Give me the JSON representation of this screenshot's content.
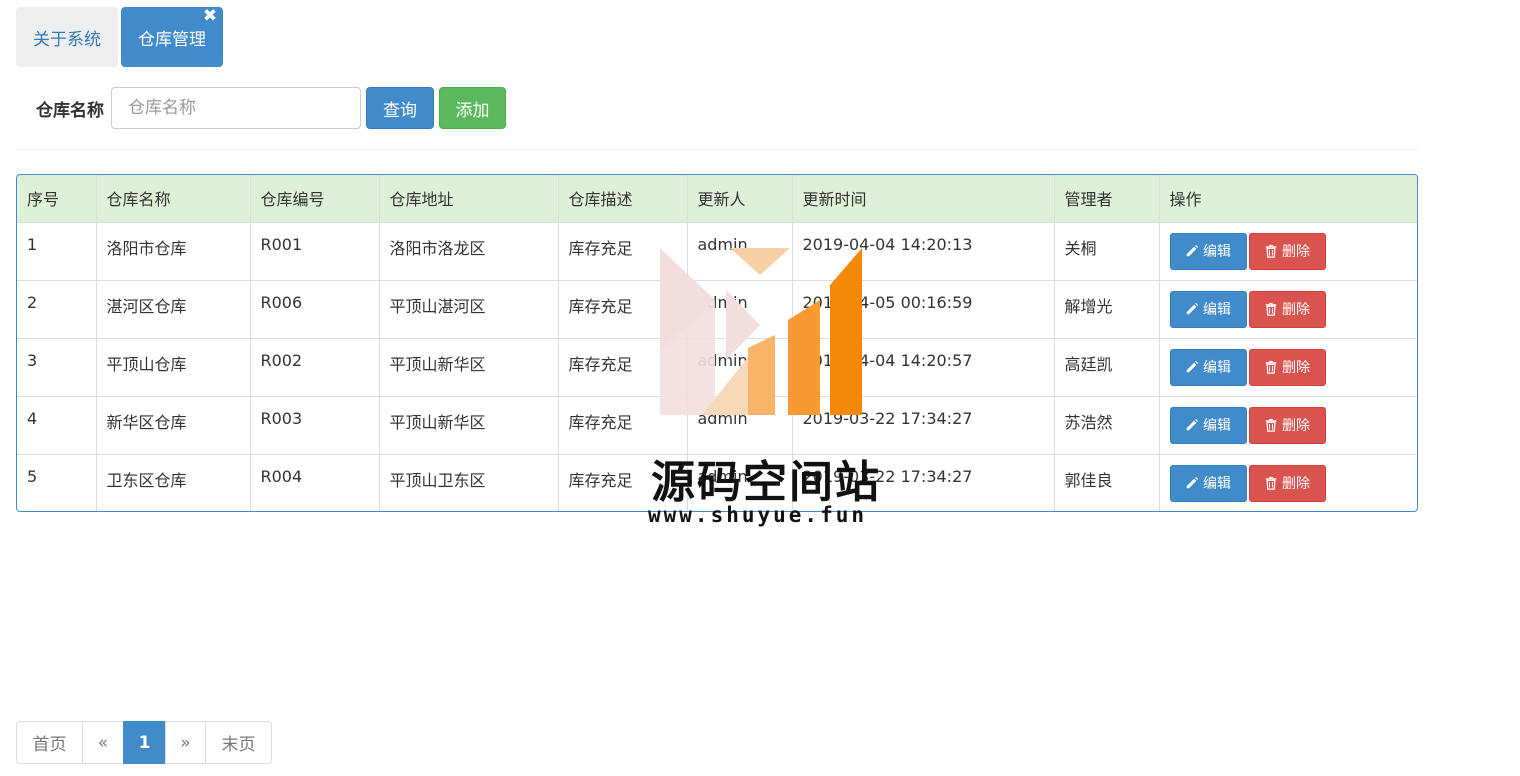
{
  "tabs": [
    {
      "label": "关于系统",
      "active": false
    },
    {
      "label": "仓库管理",
      "active": true,
      "close": "✖"
    }
  ],
  "search": {
    "label": "仓库名称",
    "placeholder": "仓库名称",
    "value": "",
    "query_button": "查询",
    "add_button": "添加"
  },
  "table": {
    "headers": [
      "序号",
      "仓库名称",
      "仓库编号",
      "仓库地址",
      "仓库描述",
      "更新人",
      "更新时间",
      "管理者",
      "操作"
    ],
    "rows": [
      {
        "index": "1",
        "name": "洛阳市仓库",
        "code": "R001",
        "address": "洛阳市洛龙区",
        "desc": "库存充足",
        "updater": "admin",
        "time": "2019-04-04 14:20:13",
        "manager": "关桐"
      },
      {
        "index": "2",
        "name": "湛河区仓库",
        "code": "R006",
        "address": "平顶山湛河区",
        "desc": "库存充足",
        "updater": "admin",
        "time": "2019-04-05 00:16:59",
        "manager": "解增光"
      },
      {
        "index": "3",
        "name": "平顶山仓库",
        "code": "R002",
        "address": "平顶山新华区",
        "desc": "库存充足",
        "updater": "admin",
        "time": "2019-04-04 14:20:57",
        "manager": "高廷凯"
      },
      {
        "index": "4",
        "name": "新华区仓库",
        "code": "R003",
        "address": "平顶山新华区",
        "desc": "库存充足",
        "updater": "admin",
        "time": "2019-03-22 17:34:27",
        "manager": "苏浩然"
      },
      {
        "index": "5",
        "name": "卫东区仓库",
        "code": "R004",
        "address": "平顶山卫东区",
        "desc": "库存充足",
        "updater": "admin",
        "time": "2019-03-22 17:34:27",
        "manager": "郭佳良"
      }
    ],
    "edit_label": "编辑",
    "delete_label": "删除"
  },
  "watermark": {
    "title": "源码空间站",
    "url": "www.shuyue.fun"
  },
  "pagination": {
    "first": "首页",
    "prev": "«",
    "current": "1",
    "next": "»",
    "last": "末页"
  },
  "colors": {
    "primary": "#428bca",
    "success": "#5cb85c",
    "danger": "#d9534f",
    "header_bg": "#dff0d8"
  }
}
